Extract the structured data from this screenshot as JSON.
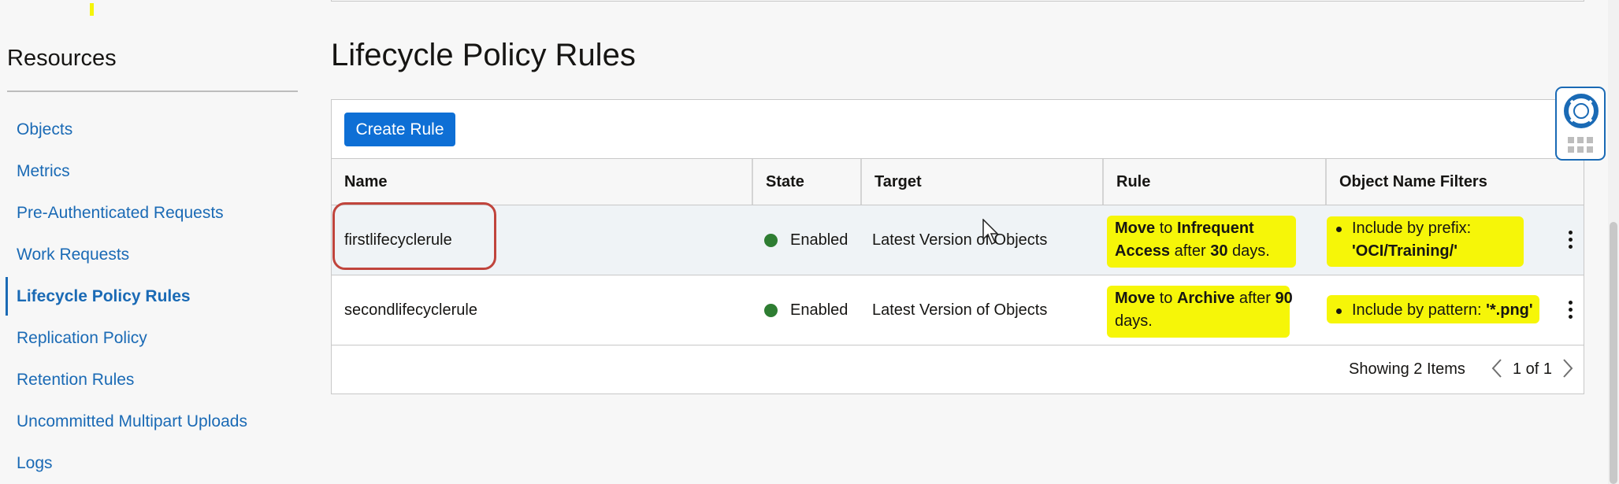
{
  "sidebar": {
    "title": "Resources",
    "items": [
      {
        "label": "Objects"
      },
      {
        "label": "Metrics"
      },
      {
        "label": "Pre-Authenticated Requests"
      },
      {
        "label": "Work Requests"
      },
      {
        "label": "Lifecycle Policy Rules",
        "active": true
      },
      {
        "label": "Replication Policy"
      },
      {
        "label": "Retention Rules"
      },
      {
        "label": "Uncommitted Multipart Uploads"
      },
      {
        "label": "Logs"
      }
    ]
  },
  "main": {
    "title": "Lifecycle Policy Rules",
    "create_button": "Create Rule",
    "columns": [
      "Name",
      "State",
      "Target",
      "Rule",
      "Object Name Filters"
    ],
    "rows": [
      {
        "name": "firstlifecyclerule",
        "state": "Enabled",
        "target": "Latest Version of Objects",
        "rule": {
          "move": "Move",
          "to": "to",
          "tier": "Infrequent Access",
          "after": "after",
          "days_num": "30",
          "days": "days."
        },
        "filter": {
          "text": "Include by prefix:",
          "value": "'OCI/Training/'"
        }
      },
      {
        "name": "secondlifecyclerule",
        "state": "Enabled",
        "target": "Latest Version of Objects",
        "rule": {
          "move": "Move",
          "to": "to",
          "tier": "Archive",
          "after": "after",
          "days_num": "90",
          "days": "days."
        },
        "filter": {
          "text": "Include by pattern:",
          "value": "'*.png'"
        }
      }
    ],
    "footer": {
      "showing": "Showing 2 Items",
      "page": "1 of 1"
    }
  },
  "colors": {
    "accent": "#0e6fd5",
    "link": "#1a6ab5",
    "enabled": "#2e7d32",
    "highlight": "#f6f608",
    "annotation_circle": "#c0443c"
  },
  "icons": [
    "help-lifebuoy-icon",
    "apps-grid-icon",
    "kebab-menu-icon",
    "chevron-left-icon",
    "chevron-right-icon",
    "status-dot-icon",
    "mouse-cursor-icon"
  ]
}
